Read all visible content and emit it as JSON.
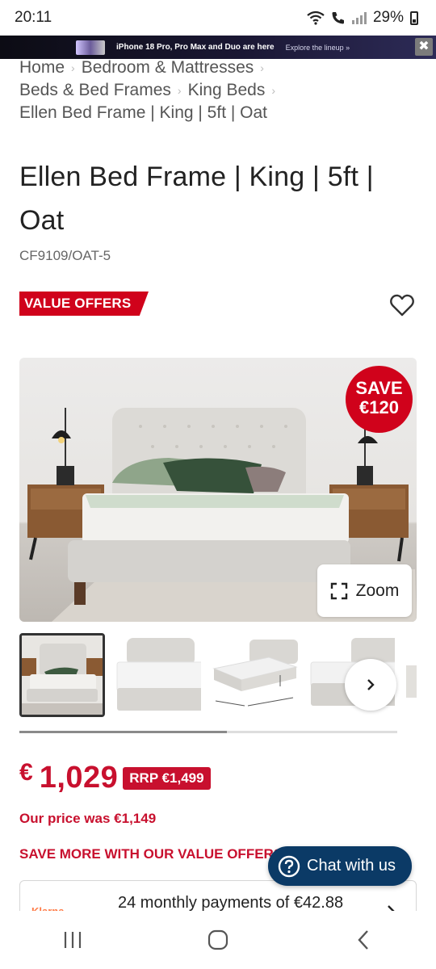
{
  "status_bar": {
    "time": "20:11",
    "battery": "29%",
    "icons": [
      "wifi-icon",
      "call-icon",
      "signal-icon",
      "battery-icon"
    ]
  },
  "ad_banner": {
    "headline": "iPhone 18 Pro, Pro Max and Duo are here",
    "cta": "Explore the lineup »",
    "close_label": "✖"
  },
  "breadcrumb": {
    "items": [
      "Home",
      "Bedroom & Mattresses",
      "Beds & Bed Frames",
      "King Beds",
      "Ellen Bed Frame | King | 5ft | Oat"
    ],
    "separator": "›"
  },
  "product": {
    "title": "Ellen Bed Frame | King | 5ft | Oat",
    "sku": "CF9109/OAT-5",
    "badge": "VALUE OFFERS",
    "save_badge_line1": "SAVE",
    "save_badge_line2": "€120",
    "zoom_label": "Zoom",
    "gallery_position": 0.55
  },
  "pricing": {
    "currency": "€",
    "price": "1,029",
    "rrp": "RRP €1,499",
    "was": "Our price was €1,149",
    "value_offers_heading": "SAVE MORE WITH OUR VALUE OFFERS"
  },
  "payment": {
    "provider": "Klarna",
    "text": "24 monthly payments of €42.88"
  },
  "chat": {
    "label": "Chat with us",
    "icon": "question-icon"
  },
  "colors": {
    "brand_red": "#c8102e",
    "chat_blue": "#0b3a66"
  }
}
